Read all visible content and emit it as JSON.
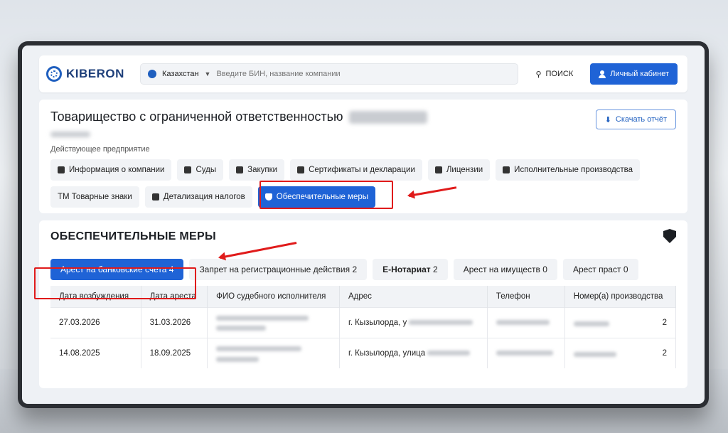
{
  "header": {
    "logo": "KIBERON",
    "country": "Казахстан",
    "search_placeholder": "Введите БИН, название компании",
    "search_button": "ПОИСК",
    "cabinet_button": "Личный кабинет"
  },
  "company": {
    "title": "Товарищество с ограниченной ответственностью",
    "status": "Действующее предприятие",
    "download_button": "Скачать отчёт"
  },
  "company_tabs_row1": [
    {
      "label": "Информация о компании",
      "icon": "document-icon"
    },
    {
      "label": "Суды",
      "icon": "scales-icon"
    },
    {
      "label": "Закупки",
      "icon": "handshake-icon"
    },
    {
      "label": "Сертификаты и декларации",
      "icon": "badge-icon"
    },
    {
      "label": "Лицензии",
      "icon": "file-icon"
    },
    {
      "label": "Исполнительные производства",
      "icon": "gavel-icon"
    }
  ],
  "company_tabs_row2": [
    {
      "label": "ТМ Товарные знаки"
    },
    {
      "label": "Детализация налогов",
      "icon": "coins-icon"
    },
    {
      "label": "Обеспечительные меры",
      "icon": "shield-icon",
      "active": true
    }
  ],
  "measures": {
    "title": "ОБЕСПЕЧИТЕЛЬНЫЕ МЕРЫ",
    "tabs": [
      {
        "label": "Арест на банковские счета",
        "count": "4",
        "active": true
      },
      {
        "label": "Запрет на регистрационные действия",
        "count": "2"
      },
      {
        "label": "E-Нотариат",
        "count": "2"
      },
      {
        "label": "Арест на имуществ",
        "count": "0"
      },
      {
        "label": "Арест праст",
        "count": "0"
      }
    ],
    "columns": [
      "Дата возбуждения",
      "Дата ареста",
      "ФИО судебного исполнителя",
      "Адрес",
      "Телефон",
      "Номер(а) производства"
    ],
    "rows": [
      {
        "start": "27.03.2026",
        "arrest": "31.03.2026",
        "address": "г. Кызылорда, у",
        "count": "2"
      },
      {
        "start": "14.08.2025",
        "arrest": "18.09.2025",
        "address": "г. Кызылорда, улица",
        "count": "2"
      }
    ]
  },
  "colors": {
    "accent": "#1f63d6",
    "highlight": "#e01b1b"
  }
}
